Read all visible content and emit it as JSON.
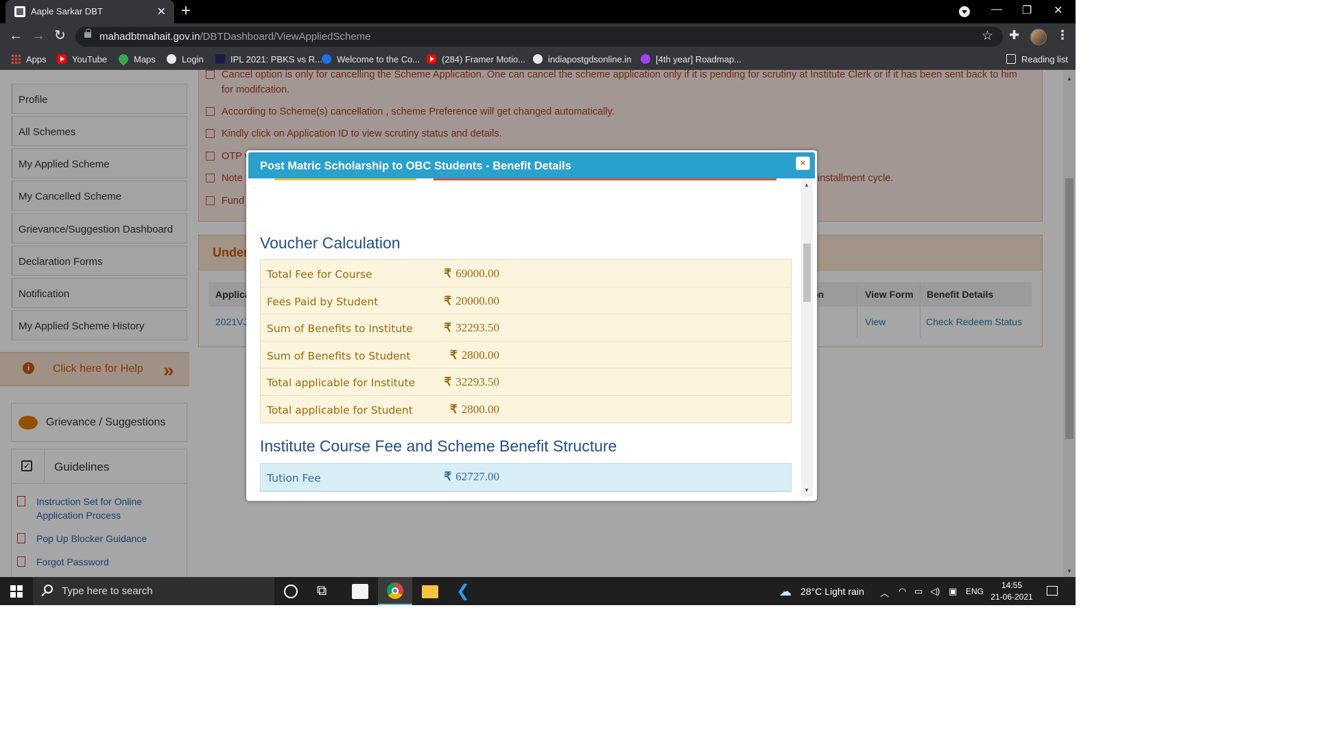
{
  "browser": {
    "tab_title": "Aaple Sarkar DBT",
    "url_host": "mahadbtmahait.gov.in",
    "url_path": "/DBTDashboard/ViewAppliedScheme",
    "bookmarks": [
      "Apps",
      "YouTube",
      "Maps",
      "Login",
      "IPL 2021: PBKS vs R...",
      "Welcome to the Co...",
      "(284) Framer Motio...",
      "indiapostgdsonline.in",
      "[4th year] Roadmap..."
    ],
    "reading_list": "Reading list"
  },
  "sidebar": {
    "links": [
      "Profile",
      "All Schemes",
      "My Applied Scheme",
      "My Cancelled Scheme",
      "Grievance/Suggestion Dashboard",
      "Declaration Forms",
      "Notification",
      "My Applied Scheme History"
    ],
    "help": "Click here for Help",
    "grievance": "Grievance / Suggestions",
    "guidelines_title": "Guidelines",
    "guidelines": [
      "Instruction Set for Online Application Process",
      "Pop Up Blocker Guidance",
      "Forgot Password"
    ]
  },
  "notice": {
    "items": [
      "Cancel option is only for cancelling the Scheme Application. One can cancel the scheme application only if it is pending for scrutiny at Institute Clerk or if it has been sent back to him",
      "for modifcation.",
      "According to Scheme(s) cancellation , scheme Preference will get changed automatically.",
      "Kindly click on Application ID to view scrutiny status and details.",
      "OTP v",
      "Note",
      "Fund"
    ],
    "note_tail": "installment cycle."
  },
  "under_panel": {
    "title": "Under",
    "columns": [
      "Applica",
      "on",
      "View Form",
      "Benefit Details"
    ],
    "row": {
      "app_id": "2021VJ",
      "view": "View",
      "benefit": "Check Redeem Status"
    }
  },
  "modal": {
    "title": "Post Matric Scholarship to OBC Students - Benefit Details",
    "close": "×",
    "currency": "₹",
    "voucher_title": "Voucher Calculation",
    "voucher_rows": [
      {
        "label": "Total Fee for Course",
        "value": "69000.00"
      },
      {
        "label": "Fees Paid by Student",
        "value": "20000.00"
      },
      {
        "label": "Sum of Benefits to Institute",
        "value": "32293.50"
      },
      {
        "label": "Sum of Benefits to Student",
        "value": "2800.00"
      },
      {
        "label": "Total applicable for Institute",
        "value": "32293.50"
      },
      {
        "label": "Total applicable for Student",
        "value": "2800.00"
      }
    ],
    "structure_title": "Institute Course Fee and Scheme Benefit Structure",
    "structure_rows": [
      {
        "label": "Tution Fee",
        "value": "62727.00"
      }
    ]
  },
  "taskbar": {
    "search_placeholder": "Type here to search",
    "weather": "28°C  Light rain",
    "lang": "ENG",
    "time": "14:55",
    "date": "21-06-2021"
  }
}
